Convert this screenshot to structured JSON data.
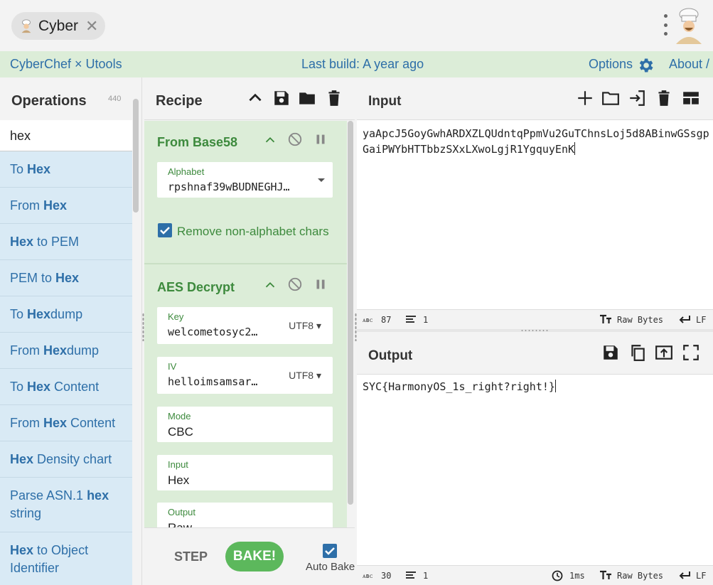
{
  "window": {
    "tab_label": "Cyber",
    "tab_icon": "chef-icon",
    "avatar_icon": "chef-avatar-icon"
  },
  "banner": {
    "left_text": "CyberChef × Utools",
    "build_text": "Last build: A year ago",
    "options_label": "Options",
    "about_label": "About /"
  },
  "operations": {
    "title": "Operations",
    "count": "440",
    "search_value": "hex",
    "items": [
      {
        "pre": "To ",
        "match": "Hex",
        "post": ""
      },
      {
        "pre": "From ",
        "match": "Hex",
        "post": ""
      },
      {
        "pre": "",
        "match": "Hex",
        "post": " to PEM"
      },
      {
        "pre": "PEM to ",
        "match": "Hex",
        "post": ""
      },
      {
        "pre": "To ",
        "match": "Hex",
        "post": "dump"
      },
      {
        "pre": "From ",
        "match": "Hex",
        "post": "dump"
      },
      {
        "pre": "To ",
        "match": "Hex",
        "post": " Content"
      },
      {
        "pre": "From ",
        "match": "Hex",
        "post": " Content"
      },
      {
        "pre": "",
        "match": "Hex",
        "post": " Density chart"
      },
      {
        "pre": "Parse ASN.1 ",
        "match": "hex",
        "post": " string"
      },
      {
        "pre": "",
        "match": "Hex",
        "post": " to Object Identifier"
      }
    ]
  },
  "recipe": {
    "title": "Recipe",
    "from_base58": {
      "name": "From Base58",
      "alphabet_label": "Alphabet",
      "alphabet_value": "rpshnaf39wBUDNEGHJ…",
      "remove_label": "Remove non-alphabet chars",
      "remove_checked": true
    },
    "aes_decrypt": {
      "name": "AES Decrypt",
      "key_label": "Key",
      "key_value": "welcometosyc2…",
      "key_encoding": "UTF8",
      "iv_label": "IV",
      "iv_value": "helloimsamsar…",
      "iv_encoding": "UTF8",
      "mode_label": "Mode",
      "mode_value": "CBC",
      "input_label": "Input",
      "input_value": "Hex",
      "output_label": "Output",
      "output_value": "Raw"
    },
    "step_label": "STEP",
    "bake_label": "BAKE!",
    "auto_bake_label": "Auto Bake",
    "auto_bake_checked": true
  },
  "input": {
    "title": "Input",
    "text": "yaApcJ5GoyGwhARDXZLQUdntqPpmVu2GuTChnsLoj5d8ABinwGSsgpGaiPWYbHTTbbzSXxLXwoLgjR1YgquyEnK",
    "status_chars": "87",
    "status_lines": "1",
    "status_format": "Raw Bytes",
    "status_eol": "LF"
  },
  "output": {
    "title": "Output",
    "text": "SYC{HarmonyOS_1s_right?right!}",
    "status_chars": "30",
    "status_lines": "1",
    "status_time": "1ms",
    "status_format": "Raw Bytes",
    "status_eol": "LF"
  },
  "colors": {
    "accent_blue": "#2e6fa8",
    "recipe_green": "#3d8a3d",
    "bake_green": "#5cb85c",
    "banner_green": "#dcedd8",
    "ops_blue": "#d9eaf5"
  }
}
